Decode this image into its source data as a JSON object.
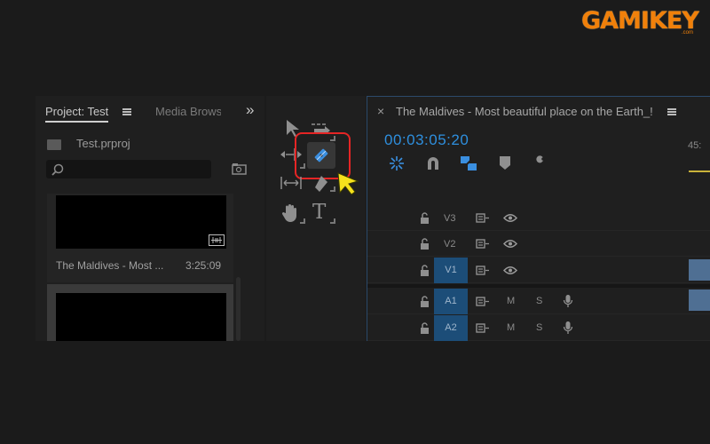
{
  "brand": {
    "logo_text": "GAMIKEY",
    "logo_suffix": ".com"
  },
  "project_panel": {
    "tabs": [
      {
        "label": "Project: Test",
        "active": true
      },
      {
        "label": "Media Brows",
        "active": false
      }
    ],
    "overflow_label": "»",
    "project_file": "Test.prproj",
    "search_placeholder": "",
    "items": [
      {
        "name": "The Maldives - Most ...",
        "duration": "3:25:09"
      }
    ]
  },
  "tools_panel": {
    "tools": [
      "selection-tool",
      "track-select-forward-tool",
      "ripple-edit-tool",
      "slip-tool",
      "pen-tool",
      "hand-tool",
      "type-tool"
    ],
    "highlighted_tool": "ripple-edit-tool",
    "type_tool_glyph": "T"
  },
  "timeline_panel": {
    "close_label": "×",
    "sequence_title": "The Maldives - Most beautiful place on the Earth_!",
    "timecode": "00:03:05:20",
    "ruler_label": "45:",
    "tracks": [
      {
        "name": "V3",
        "type": "video",
        "targeted": false,
        "has_clip": false
      },
      {
        "name": "V2",
        "type": "video",
        "targeted": false,
        "has_clip": false
      },
      {
        "name": "V1",
        "type": "video",
        "targeted": true,
        "has_clip": true
      },
      {
        "name": "A1",
        "type": "audio",
        "targeted": true,
        "has_clip": true,
        "mute": "M",
        "solo": "S"
      },
      {
        "name": "A2",
        "type": "audio",
        "targeted": true,
        "has_clip": false,
        "mute": "M",
        "solo": "S"
      }
    ]
  },
  "colors": {
    "accent_blue": "#2e8fde",
    "highlight_red": "#e52525",
    "cursor_yellow": "#f5e11c",
    "logo_orange": "#f0800a"
  }
}
